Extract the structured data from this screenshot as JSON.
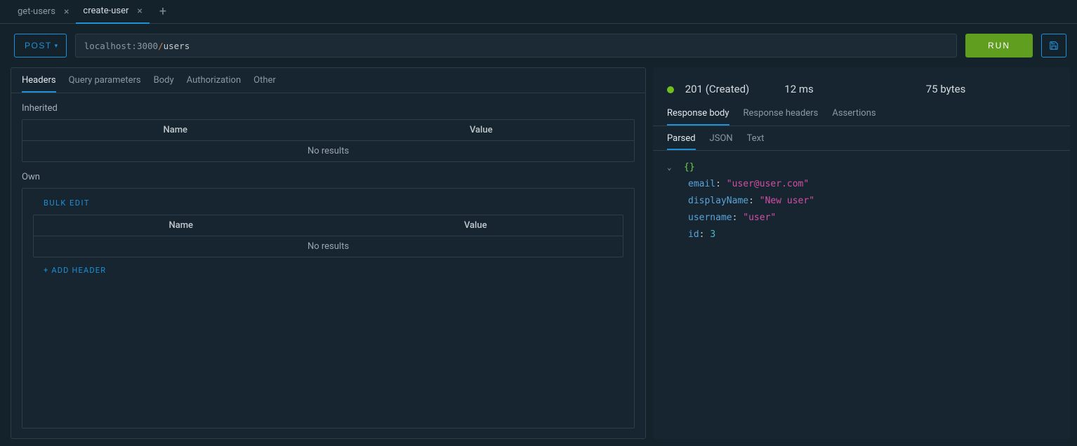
{
  "tabs": [
    {
      "label": "get-users",
      "active": false
    },
    {
      "label": "create-user",
      "active": true
    }
  ],
  "request": {
    "method": "POST",
    "url_host": "localhost:3000",
    "url_path": "users",
    "run_label": "RUN"
  },
  "left": {
    "tabs": [
      "Headers",
      "Query parameters",
      "Body",
      "Authorization",
      "Other"
    ],
    "active_tab": "Headers",
    "inherited_label": "Inherited",
    "own_label": "Own",
    "col_name": "Name",
    "col_value": "Value",
    "no_results": "No results",
    "bulk_edit": "BULK EDIT",
    "add_header": "+ ADD HEADER"
  },
  "response": {
    "status_code": "201",
    "status_text": "(Created)",
    "time": "12 ms",
    "size": "75 bytes",
    "tabs": [
      "Response body",
      "Response headers",
      "Assertions"
    ],
    "active_tab": "Response body",
    "view_tabs": [
      "Parsed",
      "JSON",
      "Text"
    ],
    "active_view": "Parsed",
    "body": [
      {
        "key": "email",
        "type": "string",
        "value": "\"user@user.com\""
      },
      {
        "key": "displayName",
        "type": "string",
        "value": "\"New user\""
      },
      {
        "key": "username",
        "type": "string",
        "value": "\"user\""
      },
      {
        "key": "id",
        "type": "number",
        "value": "3"
      }
    ],
    "braces": "{}"
  }
}
